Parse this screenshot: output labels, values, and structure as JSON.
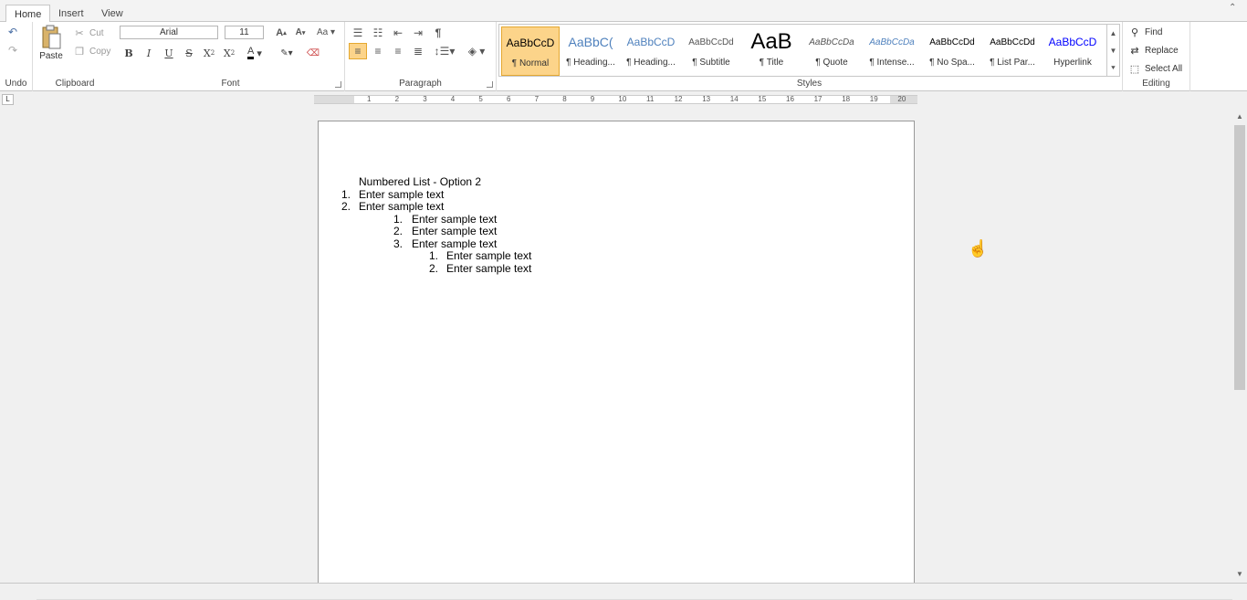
{
  "tabs": [
    {
      "label": "Home",
      "active": true
    },
    {
      "label": "Insert",
      "active": false
    },
    {
      "label": "View",
      "active": false
    }
  ],
  "ribbon": {
    "groups": {
      "undo": "Undo",
      "clipboard": "Clipboard",
      "font": "Font",
      "paragraph": "Paragraph",
      "styles": "Styles",
      "editing": "Editing"
    },
    "clipboard": {
      "paste": "Paste",
      "cut": "Cut",
      "copy": "Copy"
    },
    "font": {
      "family": "Arial",
      "size": "11"
    },
    "styles": [
      {
        "sample": "AaBbCcD",
        "name": "¶ Normal",
        "selected": true,
        "color": "#000000"
      },
      {
        "sample": "AaBbC(",
        "name": "¶ Heading...",
        "selected": false,
        "color": "#4f81bd"
      },
      {
        "sample": "AaBbCcD",
        "name": "¶ Heading...",
        "selected": false,
        "color": "#4f81bd"
      },
      {
        "sample": "AaBbCcDd",
        "name": "¶ Subtitle",
        "selected": false,
        "color": "#555555"
      },
      {
        "sample": "AaB",
        "name": "¶ Title",
        "selected": false,
        "color": "#000000"
      },
      {
        "sample": "AaBbCcDa",
        "name": "¶ Quote",
        "selected": false,
        "color": "#555555"
      },
      {
        "sample": "AaBbCcDa",
        "name": "¶ Intense...",
        "selected": false,
        "color": "#4f81bd"
      },
      {
        "sample": "AaBbCcDd",
        "name": "¶ No Spa...",
        "selected": false,
        "color": "#000000"
      },
      {
        "sample": "AaBbCcDd",
        "name": "¶ List Par...",
        "selected": false,
        "color": "#000000"
      },
      {
        "sample": "AaBbCcD",
        "name": "Hyperlink",
        "selected": false,
        "color": "#0000ff"
      }
    ],
    "editing": {
      "find": "Find",
      "replace": "Replace",
      "select_all": "Select All"
    }
  },
  "ruler": {
    "numbers": [
      "1",
      "2",
      "3",
      "4",
      "5",
      "6",
      "7",
      "8",
      "9",
      "10",
      "11",
      "12",
      "13",
      "14",
      "15",
      "16",
      "17",
      "18",
      "19",
      "20"
    ]
  },
  "document": {
    "heading": "Numbered List - Option 2",
    "items": [
      {
        "num": "1.",
        "text": "Enter sample text"
      },
      {
        "num": "2.",
        "text": "Enter sample text"
      },
      {
        "num": "1.",
        "text": "Enter sample text"
      },
      {
        "num": "2.",
        "text": "Enter sample text"
      },
      {
        "num": "3.",
        "text": "Enter sample text"
      },
      {
        "num": "1.",
        "text": "Enter sample text"
      },
      {
        "num": "2.",
        "text": "Enter sample text"
      }
    ]
  },
  "colors": {
    "accent": "#fcd48a",
    "accent_border": "#e5a830",
    "blue": "#4f81bd"
  }
}
